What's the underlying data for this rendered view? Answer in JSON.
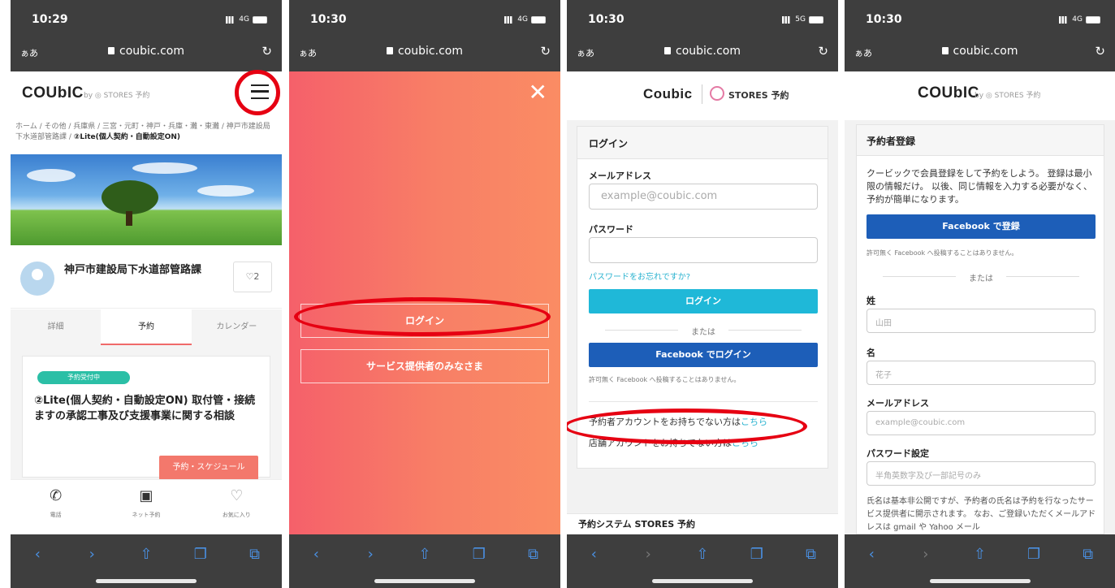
{
  "p1": {
    "time": "10:29",
    "network": "4G",
    "aa": "ぁあ",
    "url": "coubic.com",
    "logo": "COUbIC",
    "logo_sub": "by ◎ STORES 予約",
    "breadcrumb": "ホーム / その他 / 兵庫県 / 三宮・元町・神戸・兵庫・灘・東灘 / 神戸市建設局下水道部管路課 / ",
    "breadcrumb_current": "②Lite(個人契約・自動設定ON)",
    "org_name": "神戸市建設局下水道部管路課",
    "like_count": "♡2",
    "tabs": [
      "詳細",
      "予約",
      "カレンダー"
    ],
    "badge": "予約受付中",
    "plan_title": "②Lite(個人契約・自動設定ON) 取付管・接続ますの承認工事及び支援事業に関する相談",
    "schedule_btn": "予約・スケジュール",
    "footer": [
      {
        "icon": "phone-icon",
        "glyph": "✆",
        "label": "電話"
      },
      {
        "icon": "calendar-check-icon",
        "glyph": "▣",
        "label": "ネット予約"
      },
      {
        "icon": "heart-icon",
        "glyph": "♡",
        "label": "お気に入り"
      }
    ]
  },
  "p2": {
    "time": "10:30",
    "network": "4G",
    "aa": "ぁあ",
    "url": "coubic.com",
    "login_btn": "ログイン",
    "provider_btn": "サービス提供者のみなさま"
  },
  "p3": {
    "time": "10:30",
    "network": "5G",
    "aa": "ぁあ",
    "url": "coubic.com",
    "logo": "Coubic",
    "stores": "STORES 予約",
    "card_title": "ログイン",
    "email_label": "メールアドレス",
    "email_placeholder": "example@coubic.com",
    "password_label": "パスワード",
    "forgot": "パスワードをお忘れですか?",
    "login_btn": "ログイン",
    "or": "または",
    "fb_btn": "Facebook でログイン",
    "fb_note": "許可無く Facebook へ投稿することはありません。",
    "no_account": "予約者アカウントをお持ちでない方は",
    "no_store": "店舗アカウントをお持ちでない方は",
    "here": "こちら",
    "footer_title": "予約システム STORES 予約"
  },
  "p4": {
    "time": "10:30",
    "network": "4G",
    "aa": "ぁあ",
    "url": "coubic.com",
    "logo": "COUbIC",
    "logo_sub": "by ◎ STORES 予約",
    "card_title": "予約者登録",
    "intro": "クービックで会員登録をして予約をしよう。 登録は最小限の情報だけ。 以後、同じ情報を入力する必要がなく、予約が簡単になります。",
    "fb_btn": "Facebook で登録",
    "fb_note": "許可無く Facebook へ投稿することはありません。",
    "or": "または",
    "last_label": "姓",
    "last_placeholder": "山田",
    "first_label": "名",
    "first_placeholder": "花子",
    "email_label": "メールアドレス",
    "email_placeholder": "example@coubic.com",
    "password_label": "パスワード設定",
    "password_placeholder": "半角英数字及び一部記号のみ",
    "desc": "氏名は基本非公開ですが、予約者の氏名は予約を行なったサービス提供者に開示されます。 なお、ご登録いただくメールアドレスは gmail や Yahoo メール"
  },
  "colors": {
    "annotation": "#e60012",
    "accent_cyan": "#1fb8d8",
    "facebook": "#1d5eb8",
    "coral": "#f87f66",
    "badge_green": "#2bbfa6"
  }
}
